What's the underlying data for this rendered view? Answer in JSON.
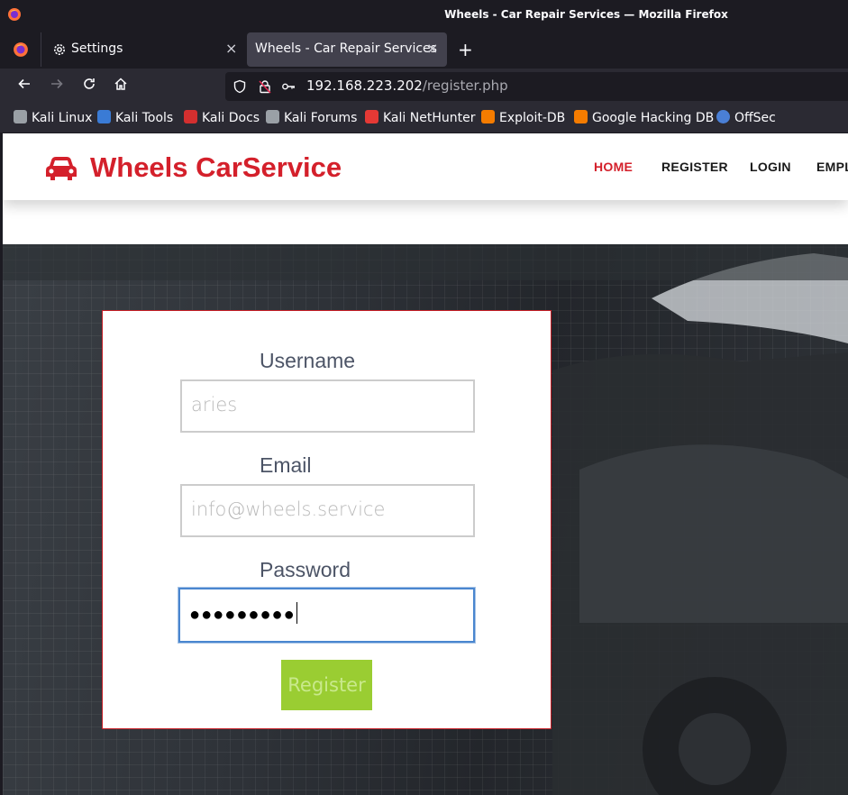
{
  "window": {
    "title": "Wheels - Car Repair Services — Mozilla Firefox"
  },
  "tabs": [
    {
      "label": "Settings",
      "icon": "gear-icon",
      "close": "×"
    },
    {
      "label": "Wheels - Car Repair Services",
      "close": "×"
    }
  ],
  "newtab": "+",
  "nav": {
    "url_host": "192.168.223.202",
    "url_path": "/register.php"
  },
  "bookmarks": [
    {
      "label": "Kali Linux",
      "color": "#9aa0a6"
    },
    {
      "label": "Kali Tools",
      "color": "#3a7bd5"
    },
    {
      "label": "Kali Docs",
      "color": "#d32f2f"
    },
    {
      "label": "Kali Forums",
      "color": "#9aa0a6"
    },
    {
      "label": "Kali NetHunter",
      "color": "#e53935"
    },
    {
      "label": "Exploit-DB",
      "color": "#f57c00"
    },
    {
      "label": "Google Hacking DB",
      "color": "#f57c00"
    },
    {
      "label": "OffSec",
      "color": "#4a7fd6"
    }
  ],
  "site": {
    "brand": "Wheels CarService",
    "brand_color": "#d4202b",
    "menu": [
      "HOME",
      "REGISTER",
      "LOGIN",
      "EMPL"
    ]
  },
  "form": {
    "username_label": "Username",
    "username_value": "aries",
    "email_label": "Email",
    "email_value": "info@wheels.service",
    "password_label": "Password",
    "password_value": "●●●●●●●●●",
    "submit_label": "Register",
    "submit_color": "#9acd32"
  }
}
